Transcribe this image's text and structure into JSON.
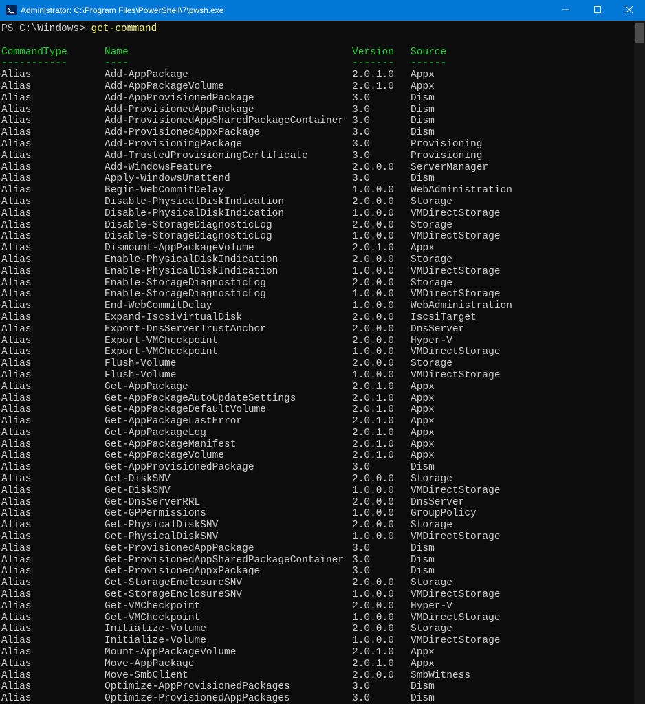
{
  "titlebar": {
    "title": "Administrator: C:\\Program Files\\PowerShell\\7\\pwsh.exe"
  },
  "prompt": {
    "ps": "PS C:\\Windows> ",
    "command": "get-command"
  },
  "headers": {
    "c1": "CommandType",
    "c2": "Name",
    "c3": "Version",
    "c4": "Source",
    "u1": "-----------",
    "u2": "----",
    "u3": "-------",
    "u4": "------"
  },
  "rows": [
    {
      "t": "Alias",
      "n": "Add-AppPackage",
      "v": "2.0.1.0",
      "s": "Appx"
    },
    {
      "t": "Alias",
      "n": "Add-AppPackageVolume",
      "v": "2.0.1.0",
      "s": "Appx"
    },
    {
      "t": "Alias",
      "n": "Add-AppProvisionedPackage",
      "v": "3.0",
      "s": "Dism"
    },
    {
      "t": "Alias",
      "n": "Add-ProvisionedAppPackage",
      "v": "3.0",
      "s": "Dism"
    },
    {
      "t": "Alias",
      "n": "Add-ProvisionedAppSharedPackageContainer",
      "v": "3.0",
      "s": "Dism"
    },
    {
      "t": "Alias",
      "n": "Add-ProvisionedAppxPackage",
      "v": "3.0",
      "s": "Dism"
    },
    {
      "t": "Alias",
      "n": "Add-ProvisioningPackage",
      "v": "3.0",
      "s": "Provisioning"
    },
    {
      "t": "Alias",
      "n": "Add-TrustedProvisioningCertificate",
      "v": "3.0",
      "s": "Provisioning"
    },
    {
      "t": "Alias",
      "n": "Add-WindowsFeature",
      "v": "2.0.0.0",
      "s": "ServerManager"
    },
    {
      "t": "Alias",
      "n": "Apply-WindowsUnattend",
      "v": "3.0",
      "s": "Dism"
    },
    {
      "t": "Alias",
      "n": "Begin-WebCommitDelay",
      "v": "1.0.0.0",
      "s": "WebAdministration"
    },
    {
      "t": "Alias",
      "n": "Disable-PhysicalDiskIndication",
      "v": "2.0.0.0",
      "s": "Storage"
    },
    {
      "t": "Alias",
      "n": "Disable-PhysicalDiskIndication",
      "v": "1.0.0.0",
      "s": "VMDirectStorage"
    },
    {
      "t": "Alias",
      "n": "Disable-StorageDiagnosticLog",
      "v": "2.0.0.0",
      "s": "Storage"
    },
    {
      "t": "Alias",
      "n": "Disable-StorageDiagnosticLog",
      "v": "1.0.0.0",
      "s": "VMDirectStorage"
    },
    {
      "t": "Alias",
      "n": "Dismount-AppPackageVolume",
      "v": "2.0.1.0",
      "s": "Appx"
    },
    {
      "t": "Alias",
      "n": "Enable-PhysicalDiskIndication",
      "v": "2.0.0.0",
      "s": "Storage"
    },
    {
      "t": "Alias",
      "n": "Enable-PhysicalDiskIndication",
      "v": "1.0.0.0",
      "s": "VMDirectStorage"
    },
    {
      "t": "Alias",
      "n": "Enable-StorageDiagnosticLog",
      "v": "2.0.0.0",
      "s": "Storage"
    },
    {
      "t": "Alias",
      "n": "Enable-StorageDiagnosticLog",
      "v": "1.0.0.0",
      "s": "VMDirectStorage"
    },
    {
      "t": "Alias",
      "n": "End-WebCommitDelay",
      "v": "1.0.0.0",
      "s": "WebAdministration"
    },
    {
      "t": "Alias",
      "n": "Expand-IscsiVirtualDisk",
      "v": "2.0.0.0",
      "s": "IscsiTarget"
    },
    {
      "t": "Alias",
      "n": "Export-DnsServerTrustAnchor",
      "v": "2.0.0.0",
      "s": "DnsServer"
    },
    {
      "t": "Alias",
      "n": "Export-VMCheckpoint",
      "v": "2.0.0.0",
      "s": "Hyper-V"
    },
    {
      "t": "Alias",
      "n": "Export-VMCheckpoint",
      "v": "1.0.0.0",
      "s": "VMDirectStorage"
    },
    {
      "t": "Alias",
      "n": "Flush-Volume",
      "v": "2.0.0.0",
      "s": "Storage"
    },
    {
      "t": "Alias",
      "n": "Flush-Volume",
      "v": "1.0.0.0",
      "s": "VMDirectStorage"
    },
    {
      "t": "Alias",
      "n": "Get-AppPackage",
      "v": "2.0.1.0",
      "s": "Appx"
    },
    {
      "t": "Alias",
      "n": "Get-AppPackageAutoUpdateSettings",
      "v": "2.0.1.0",
      "s": "Appx"
    },
    {
      "t": "Alias",
      "n": "Get-AppPackageDefaultVolume",
      "v": "2.0.1.0",
      "s": "Appx"
    },
    {
      "t": "Alias",
      "n": "Get-AppPackageLastError",
      "v": "2.0.1.0",
      "s": "Appx"
    },
    {
      "t": "Alias",
      "n": "Get-AppPackageLog",
      "v": "2.0.1.0",
      "s": "Appx"
    },
    {
      "t": "Alias",
      "n": "Get-AppPackageManifest",
      "v": "2.0.1.0",
      "s": "Appx"
    },
    {
      "t": "Alias",
      "n": "Get-AppPackageVolume",
      "v": "2.0.1.0",
      "s": "Appx"
    },
    {
      "t": "Alias",
      "n": "Get-AppProvisionedPackage",
      "v": "3.0",
      "s": "Dism"
    },
    {
      "t": "Alias",
      "n": "Get-DiskSNV",
      "v": "2.0.0.0",
      "s": "Storage"
    },
    {
      "t": "Alias",
      "n": "Get-DiskSNV",
      "v": "1.0.0.0",
      "s": "VMDirectStorage"
    },
    {
      "t": "Alias",
      "n": "Get-DnsServerRRL",
      "v": "2.0.0.0",
      "s": "DnsServer"
    },
    {
      "t": "Alias",
      "n": "Get-GPPermissions",
      "v": "1.0.0.0",
      "s": "GroupPolicy"
    },
    {
      "t": "Alias",
      "n": "Get-PhysicalDiskSNV",
      "v": "2.0.0.0",
      "s": "Storage"
    },
    {
      "t": "Alias",
      "n": "Get-PhysicalDiskSNV",
      "v": "1.0.0.0",
      "s": "VMDirectStorage"
    },
    {
      "t": "Alias",
      "n": "Get-ProvisionedAppPackage",
      "v": "3.0",
      "s": "Dism"
    },
    {
      "t": "Alias",
      "n": "Get-ProvisionedAppSharedPackageContainer",
      "v": "3.0",
      "s": "Dism"
    },
    {
      "t": "Alias",
      "n": "Get-ProvisionedAppxPackage",
      "v": "3.0",
      "s": "Dism"
    },
    {
      "t": "Alias",
      "n": "Get-StorageEnclosureSNV",
      "v": "2.0.0.0",
      "s": "Storage"
    },
    {
      "t": "Alias",
      "n": "Get-StorageEnclosureSNV",
      "v": "1.0.0.0",
      "s": "VMDirectStorage"
    },
    {
      "t": "Alias",
      "n": "Get-VMCheckpoint",
      "v": "2.0.0.0",
      "s": "Hyper-V"
    },
    {
      "t": "Alias",
      "n": "Get-VMCheckpoint",
      "v": "1.0.0.0",
      "s": "VMDirectStorage"
    },
    {
      "t": "Alias",
      "n": "Initialize-Volume",
      "v": "2.0.0.0",
      "s": "Storage"
    },
    {
      "t": "Alias",
      "n": "Initialize-Volume",
      "v": "1.0.0.0",
      "s": "VMDirectStorage"
    },
    {
      "t": "Alias",
      "n": "Mount-AppPackageVolume",
      "v": "2.0.1.0",
      "s": "Appx"
    },
    {
      "t": "Alias",
      "n": "Move-AppPackage",
      "v": "2.0.1.0",
      "s": "Appx"
    },
    {
      "t": "Alias",
      "n": "Move-SmbClient",
      "v": "2.0.0.0",
      "s": "SmbWitness"
    },
    {
      "t": "Alias",
      "n": "Optimize-AppProvisionedPackages",
      "v": "3.0",
      "s": "Dism"
    },
    {
      "t": "Alias",
      "n": "Optimize-ProvisionedAppPackages",
      "v": "3.0",
      "s": "Dism"
    }
  ]
}
